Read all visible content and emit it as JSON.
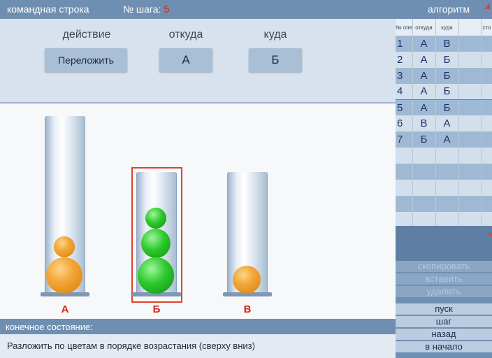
{
  "topbar": {
    "command_title": "командная строка",
    "step_label": "№ шага:",
    "step_value": "5",
    "algorithm_title": "алгоритм"
  },
  "command": {
    "action_label": "действие",
    "from_label": "откуда",
    "to_label": "куда",
    "action_value": "Переложить",
    "from_value": "А",
    "to_value": "Б"
  },
  "tubes": [
    {
      "label": "А",
      "balls": [
        "orange small",
        "orange large"
      ]
    },
    {
      "label": "Б",
      "balls": [
        "green small",
        "green medium",
        "green large"
      ],
      "selected": true
    },
    {
      "label": "В",
      "balls": [
        "orange medium"
      ]
    }
  ],
  "final": {
    "header": "конечное состояние:",
    "text": "Разложить по цветам в порядке возрастания (сверху вниз)"
  },
  "algorithm": {
    "headers": [
      "№ опер.",
      "откуда",
      "куда",
      "",
      "сто"
    ],
    "rows": [
      {
        "num": "1",
        "from": "А",
        "to": "В"
      },
      {
        "num": "2",
        "from": "А",
        "to": "Б"
      },
      {
        "num": "3",
        "from": "А",
        "to": "Б"
      },
      {
        "num": "4",
        "from": "А",
        "to": "Б"
      },
      {
        "num": "5",
        "from": "А",
        "to": "Б"
      },
      {
        "num": "6",
        "from": "В",
        "to": "А"
      },
      {
        "num": "7",
        "from": "Б",
        "to": "А"
      },
      {
        "num": "",
        "from": "",
        "to": ""
      },
      {
        "num": "",
        "from": "",
        "to": ""
      },
      {
        "num": "",
        "from": "",
        "to": ""
      },
      {
        "num": "",
        "from": "",
        "to": ""
      },
      {
        "num": "",
        "from": "",
        "to": ""
      }
    ],
    "current_row": 4
  },
  "buttons": {
    "copy": "скопировать",
    "paste": "вставить",
    "delete": "удалить",
    "run": "пуск",
    "step": "шаг",
    "back": "назад",
    "to_start": "в начало"
  },
  "colors": {
    "header_bar": "#6f8fb2",
    "accent_red": "#d2261d",
    "ball_orange": "#f2a636",
    "ball_green": "#2cc92c"
  }
}
